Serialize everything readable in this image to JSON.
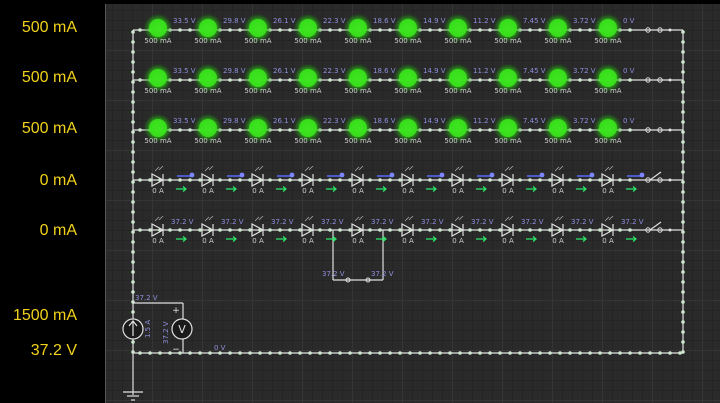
{
  "readouts": {
    "row1_current": "500 mA",
    "row2_current": "500 mA",
    "row3_current": "500 mA",
    "row4_current": "0 mA",
    "row5_current": "0 mA",
    "source_current": "1500 mA",
    "source_voltage": "37.2 V"
  },
  "lit_rows": {
    "node_voltages": [
      "33.5 V",
      "29.8 V",
      "26.1 V",
      "22.3 V",
      "18.6 V",
      "14.9 V",
      "11.2 V",
      "7.45 V",
      "3.72 V",
      "0 V"
    ],
    "led_current": "500 mA"
  },
  "dark_row5": {
    "node_voltage": "37.2 V",
    "led_current": "0 A",
    "bypass_left_voltage": "37.2 V",
    "bypass_right_voltage": "37.2 V"
  },
  "dark_row4": {
    "led_current": "0 A"
  },
  "source": {
    "top_voltage": "37.2 V",
    "bottom_voltage": "0 V",
    "current_label": "1.5 A",
    "meter_label": "37.2 V",
    "meter_symbol": "V",
    "plus": "+",
    "minus": "−"
  },
  "colors": {
    "wire": "#e0e0e0",
    "led_lit": "#39e21d",
    "led_glow": "#55ff22",
    "arrow_green": "#2ee86a",
    "dot_blue": "#7c86ff",
    "label_blue": "#8f8fe0",
    "readout_yellow": "#f2d21b"
  }
}
